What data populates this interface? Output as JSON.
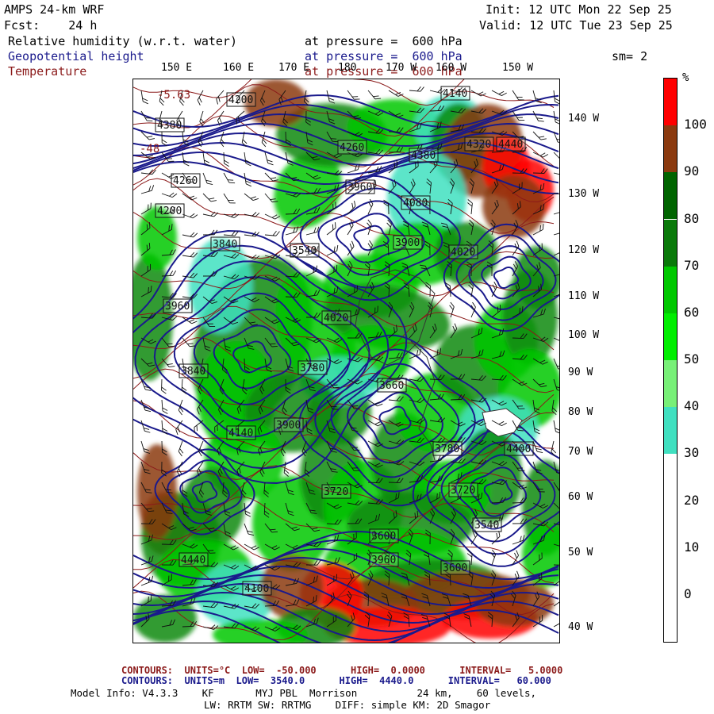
{
  "header": {
    "model_title": "AMPS 24-km WRF",
    "forecast": "Fcst:    24 h",
    "init": "Init: 12 UTC Mon 22 Sep 25",
    "valid": "Valid: 12 UTC Tue 23 Sep 25",
    "field1": "Relative humidity (w.r.t. water)",
    "field2": "Geopotential height",
    "field3": "Temperature",
    "level1": "at pressure =  600 hPa",
    "level2": "at pressure =  600 hPa",
    "level3": "at pressure =  600 hPa",
    "smoothing": "sm= 2"
  },
  "longitude_labels": [
    "150 E",
    "160 E",
    "170 E",
    "180",
    "170 W",
    "160 W",
    "150 W"
  ],
  "latitude_labels": [
    "140 W",
    "130 W",
    "120 W",
    "110 W",
    "100 W",
    "90 W",
    "80 W",
    "70 W",
    "60 W",
    "50 W",
    "40 W"
  ],
  "legend": {
    "unit": "%",
    "labels": [
      "100",
      "90",
      "80",
      "70",
      "60",
      "50",
      "40",
      "30",
      "20",
      "10",
      "0"
    ],
    "colors": [
      "#ff0000",
      "#8b3a0f",
      "#006400",
      "#0a7a0a",
      "#00c800",
      "#00ee00",
      "#78f078",
      "#40e0c0",
      "#ffffff",
      "#ffffff",
      "#ffffff",
      "#ffffff"
    ]
  },
  "height_labels": [
    "4380",
    "4200",
    "4260",
    "4140",
    "3960",
    "4320",
    "4020",
    "4080",
    "3840",
    "3900",
    "3720",
    "3780",
    "3600",
    "3660",
    "3540",
    "4440",
    "4400",
    "4100"
  ],
  "temp_labels": [
    "-5.63",
    "-48"
  ],
  "footer": {
    "line1_label": "CONTOURS:  UNITS=°C  LOW=  -50.000      HIGH=  0.0000      INTERVAL=   5.0000",
    "line2_label": "CONTOURS:  UNITS=m  LOW=  3540.0      HIGH=  4440.0      INTERVAL=   60.000",
    "model_info": "Model Info: V4.3.3    KF       MYJ PBL  Morrison          24 km,    60 levels,",
    "physics": "LW: RRTM SW: RRTMG    DIFF: simple KM: 2D Smagor"
  }
}
